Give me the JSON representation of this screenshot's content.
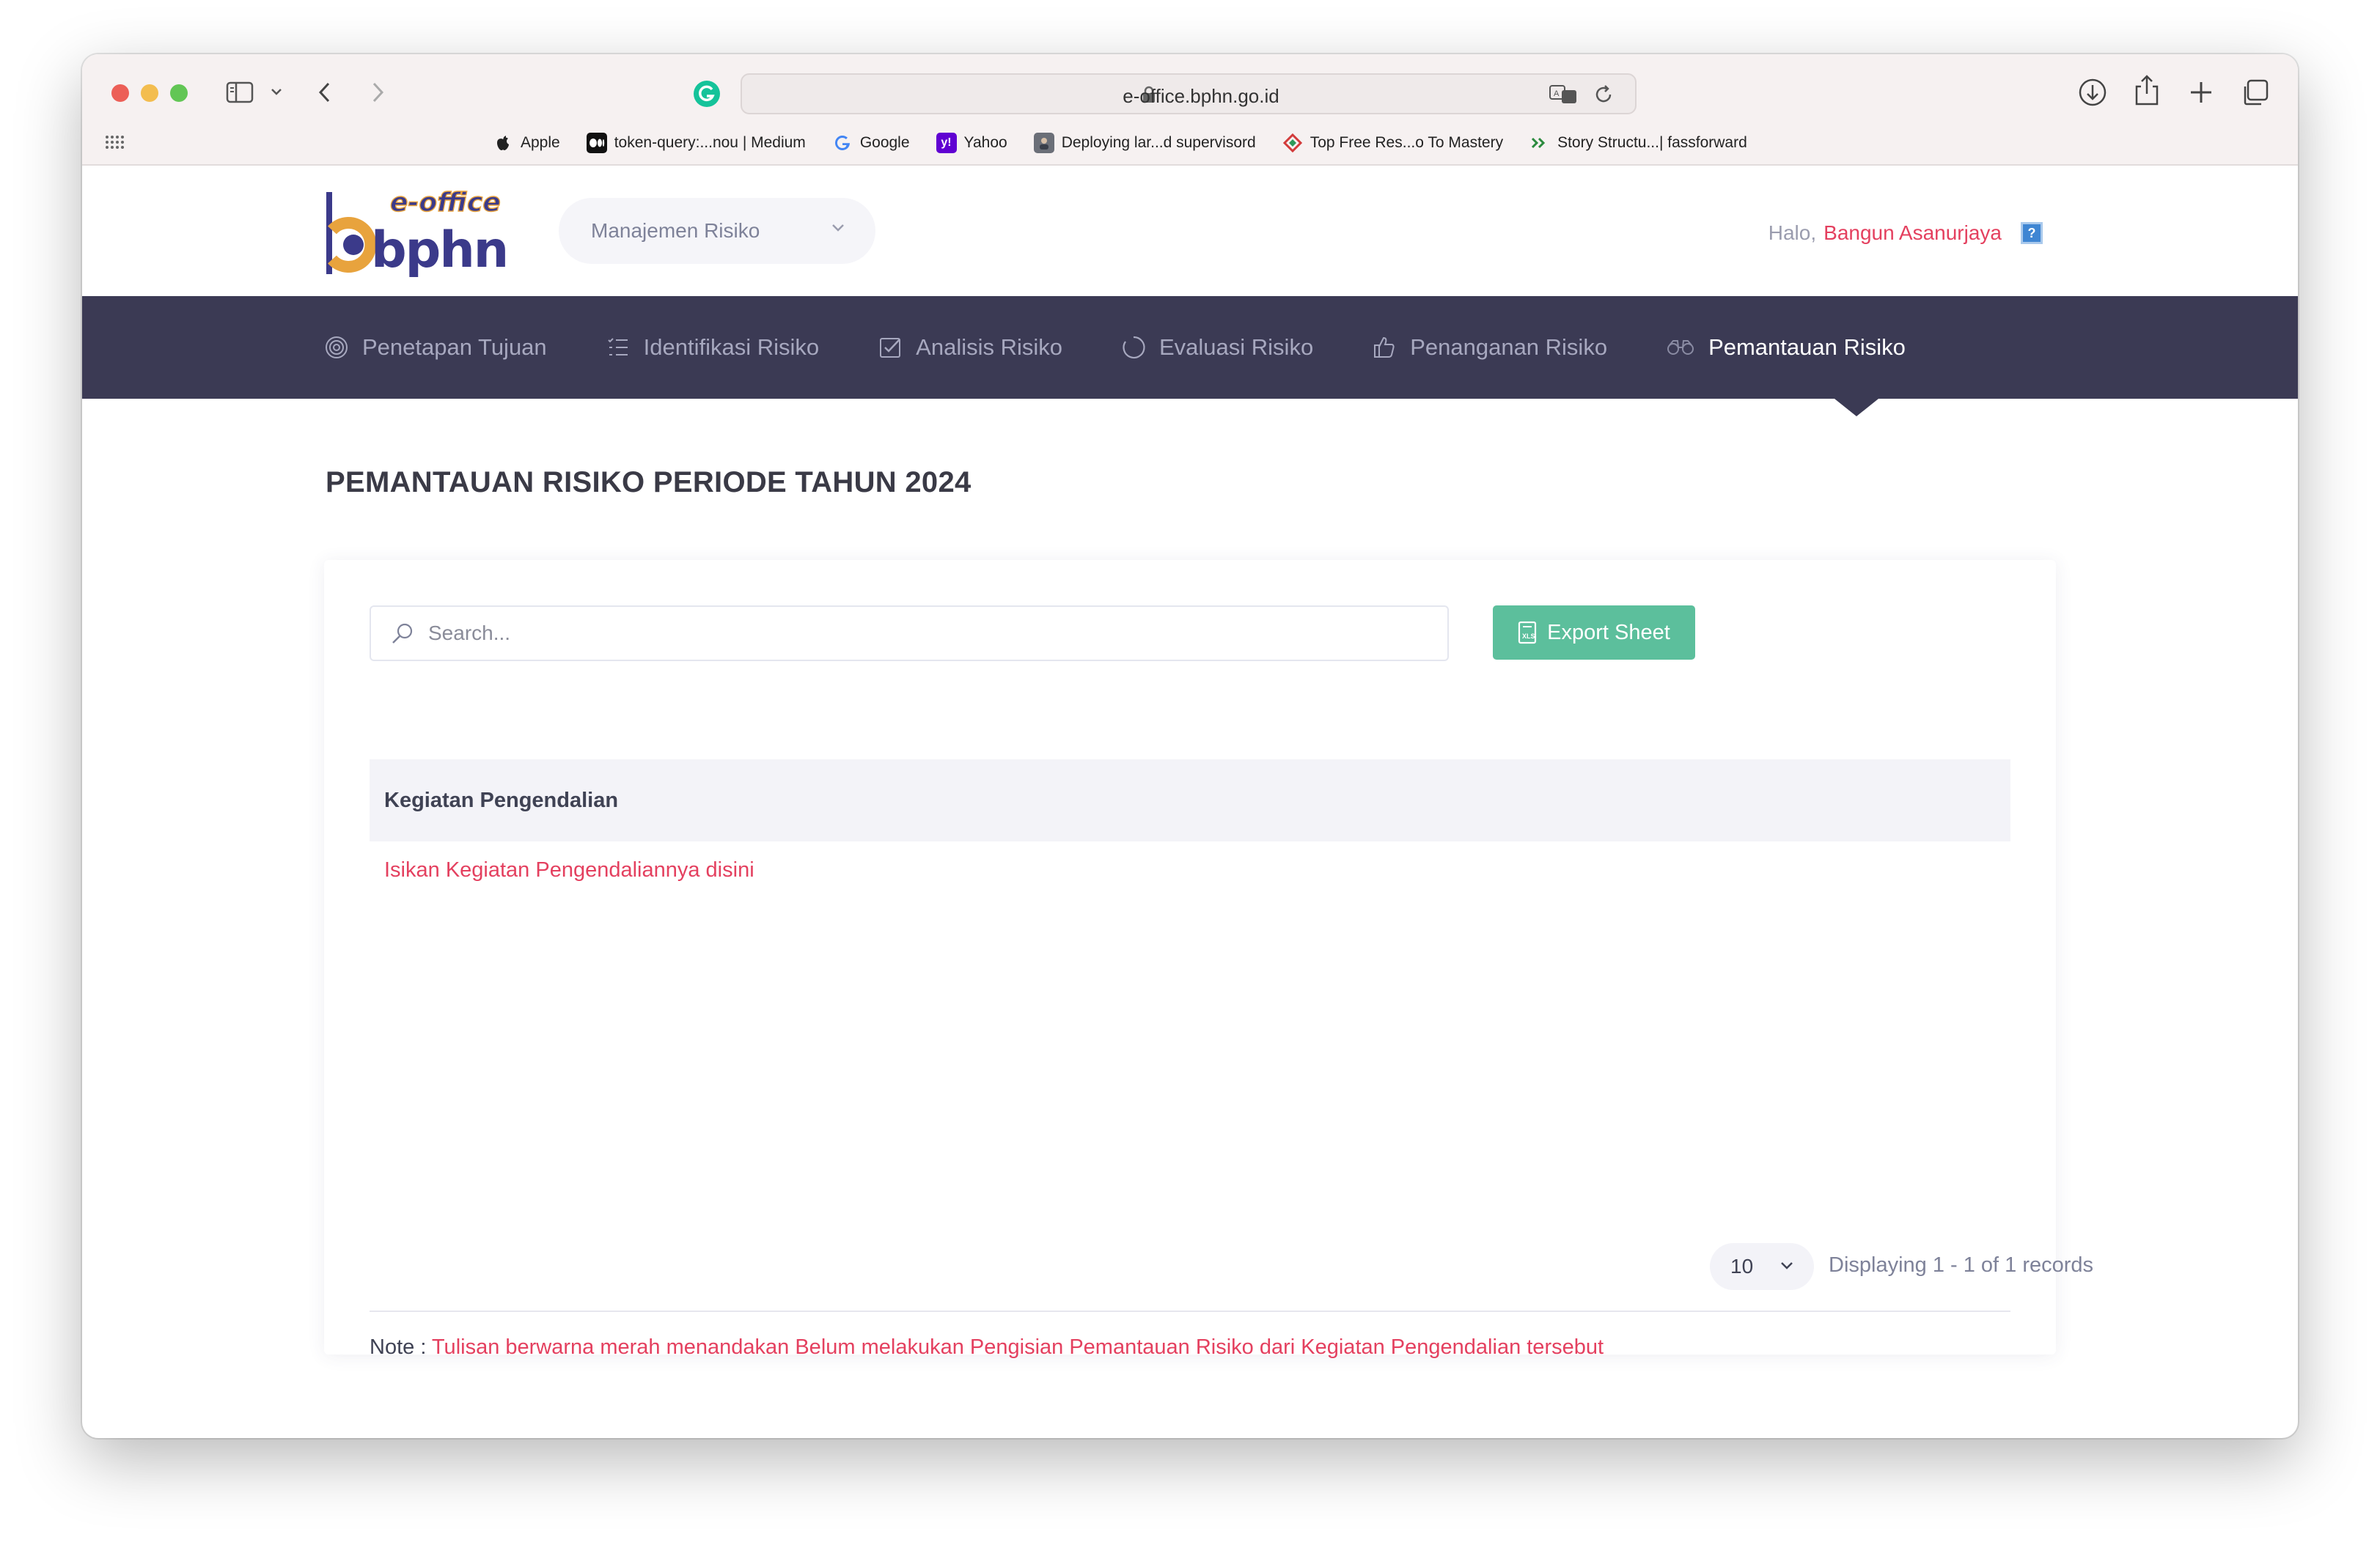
{
  "browser": {
    "url": "e-office.bphn.go.id",
    "bookmarks": [
      {
        "label": "Apple",
        "icon": "apple-icon"
      },
      {
        "label": "token-query:...nou | Medium",
        "icon": "medium-icon"
      },
      {
        "label": "Google",
        "icon": "google-icon"
      },
      {
        "label": "Yahoo",
        "icon": "yahoo-icon"
      },
      {
        "label": "Deploying lar...d supervisord",
        "icon": "site-icon"
      },
      {
        "label": "Top Free Res...o To Mastery",
        "icon": "site-icon"
      },
      {
        "label": "Story Structu...| fassforward",
        "icon": "site-icon"
      }
    ]
  },
  "app": {
    "logo_top": "e-office",
    "logo_bottom": "bphn",
    "module_select": "Manajemen Risiko",
    "greeting_prefix": "Halo,",
    "user_name": "Bangun Asanurjaya",
    "help_label": "?"
  },
  "nav": {
    "items": [
      {
        "label": "Penetapan Tujuan",
        "icon": "target-icon",
        "active": false
      },
      {
        "label": "Identifikasi Risiko",
        "icon": "list-icon",
        "active": false
      },
      {
        "label": "Analisis Risiko",
        "icon": "checkbox-icon",
        "active": false
      },
      {
        "label": "Evaluasi Risiko",
        "icon": "circle-icon",
        "active": false
      },
      {
        "label": "Penanganan Risiko",
        "icon": "thumbs-up-icon",
        "active": false
      },
      {
        "label": "Pemantauan Risiko",
        "icon": "binoculars-icon",
        "active": true
      }
    ]
  },
  "page": {
    "title": "PEMANTAUAN RISIKO PERIODE TAHUN 2024",
    "search_placeholder": "Search...",
    "export_label": "Export Sheet",
    "table": {
      "header": "Kegiatan Pengendalian",
      "rows": [
        "Isikan Kegiatan Pengendaliannya disini"
      ]
    },
    "page_size": "10",
    "pager_info": "Displaying 1 - 1 of 1 records",
    "note_label": "Note :",
    "note_text": "Tulisan berwarna merah menandakan Belum melakukan Pengisian Pemantauan Risiko dari Kegiatan Pengendalian tersebut"
  },
  "colors": {
    "nav_bg": "#3b3a54",
    "accent_red": "#e4405f",
    "export_green": "#5cbf9c"
  }
}
